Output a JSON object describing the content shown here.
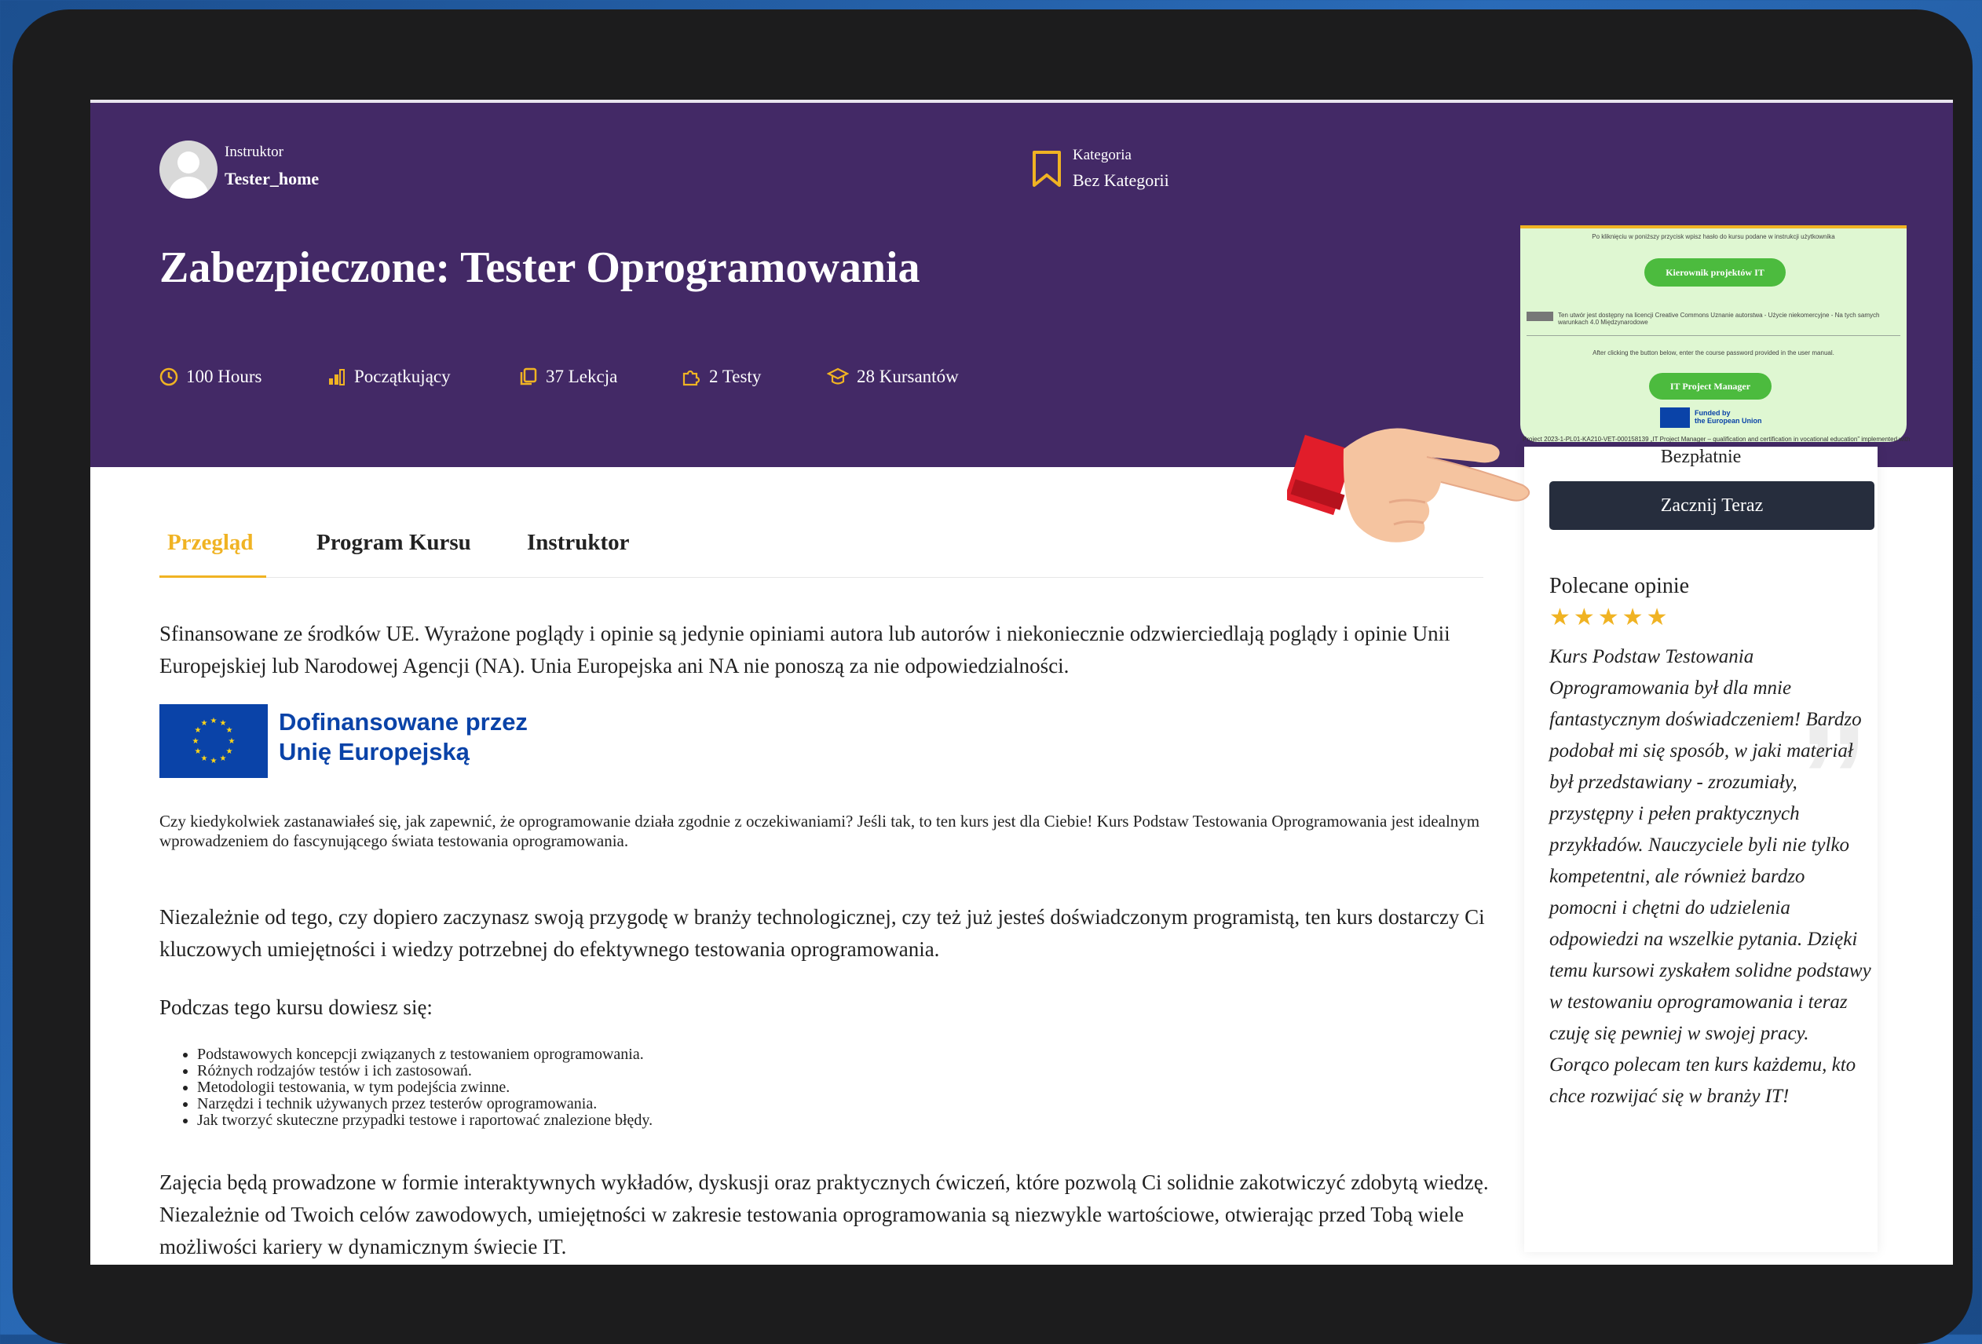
{
  "instructor": {
    "label": "Instruktor",
    "name": "Tester_home"
  },
  "category": {
    "label": "Kategoria",
    "value": "Bez Kategorii"
  },
  "course_title": "Zabezpieczone: Tester Oprogramowania",
  "stats": [
    {
      "icon": "clock-icon",
      "text": "100 Hours"
    },
    {
      "icon": "level-bars-icon",
      "text": "Początkujący"
    },
    {
      "icon": "copy-lessons-icon",
      "text": "37 Lekcja"
    },
    {
      "icon": "puzzle-icon",
      "text": "2 Testy"
    },
    {
      "icon": "graduation-cap-icon",
      "text": "28 Kursantów"
    }
  ],
  "tabs": [
    "Przegląd",
    "Program Kursu",
    "Instruktor"
  ],
  "content": {
    "disclaimer": "Sfinansowane ze środków UE. Wyrażone poglądy i opinie są jedynie opiniami autora lub autorów i niekoniecznie odzwierciedlają poglądy i opinie Unii Europejskiej lub Narodowej Agencji (NA). Unia Europejska ani NA nie ponoszą za nie odpowiedzialności.",
    "eu_logo_line1": "Dofinansowane przez",
    "eu_logo_line2": "Unię Europejską",
    "intro": "Czy kiedykolwiek zastanawiałeś się, jak zapewnić, że oprogramowanie działa zgodnie z oczekiwaniami? Jeśli tak, to ten kurs jest dla Ciebie! Kurs Podstaw Testowania Oprogramowania jest idealnym wprowadzeniem do fascynującego świata testowania oprogramowania.",
    "para2": "Niezależnie od tego, czy dopiero zaczynasz swoją przygodę w branży technologicznej, czy też już jesteś doświadczonym programistą, ten kurs dostarczy Ci kluczowych umiejętności i wiedzy potrzebnej do efektywnego testowania oprogramowania.",
    "learn_heading": "Podczas tego kursu dowiesz się:",
    "learn_items": [
      "Podstawowych koncepcji związanych z testowaniem oprogramowania.",
      "Różnych rodzajów testów i ich zastosowań.",
      "Metodologii testowania, w tym podejścia zwinne.",
      "Narzędzi i technik używanych przez testerów oprogramowania.",
      "Jak tworzyć skuteczne przypadki testowe i raportować znalezione błędy."
    ],
    "para3": "Zajęcia będą prowadzone w formie interaktywnych wykładów, dyskusji oraz praktycznych ćwiczeń, które pozwolą Ci solidnie zakotwiczyć zdobytą wiedzę. Niezależnie od Twoich celów zawodowych, umiejętności w zakresie testowania oprogramowania są niezwykle wartościowe, otwierając przed Tobą wiele możliwości kariery w dynamicznym świecie IT."
  },
  "popup": {
    "top_note": "Po kliknięciu w poniższy przycisk wpisz hasło do kursu podane w instrukcji użytkownika",
    "btn_pl": "Kierownik projektów IT",
    "license_note": "Ten utwór jest dostępny na licencji Creative Commons Uznanie autorstwa - Użycie niekomercyjne - Na tych samych warunkach 4.0 Międzynarodowe",
    "en_note": "After clicking the button below, enter the course password provided in the user manual.",
    "btn_en": "IT Project Manager",
    "funded_line1": "Funded by",
    "funded_line2": "the European Union",
    "project_note": "Project 2023-1-PL01-KA210-VET-000158139 „IT Project Manager – qualification and certification in vocational education” implemented with"
  },
  "sidebar": {
    "price": "Bezpłatnie",
    "start_button": "Zacznij Teraz",
    "reviews_title": "Polecane opinie",
    "stars": "★★★★★",
    "rating": 5,
    "review_text": "Kurs Podstaw Testowania Oprogramowania był dla mnie fantastycznym doświadczeniem! Bardzo podobał mi się sposób, w jaki materiał był przedstawiany - zrozumiały, przystępny i pełen praktycznych przykładów. Nauczyciele byli nie tylko kompetentni, ale również bardzo pomocni i chętni do udzielenia odpowiedzi na wszelkie pytania. Dzięki temu kursowi zyskałem solidne podstawy w testowaniu oprogramowania i teraz czuję się pewniej w swojej pracy. Gorąco polecam ten kurs każdemu, kto chce rozwijać się w branży IT!"
  },
  "colors": {
    "hero": "#432966",
    "accent": "#f0b323",
    "button_dark": "#262d3d",
    "popup_bg": "#dff7d2",
    "popup_btn": "#4cbb3e"
  }
}
